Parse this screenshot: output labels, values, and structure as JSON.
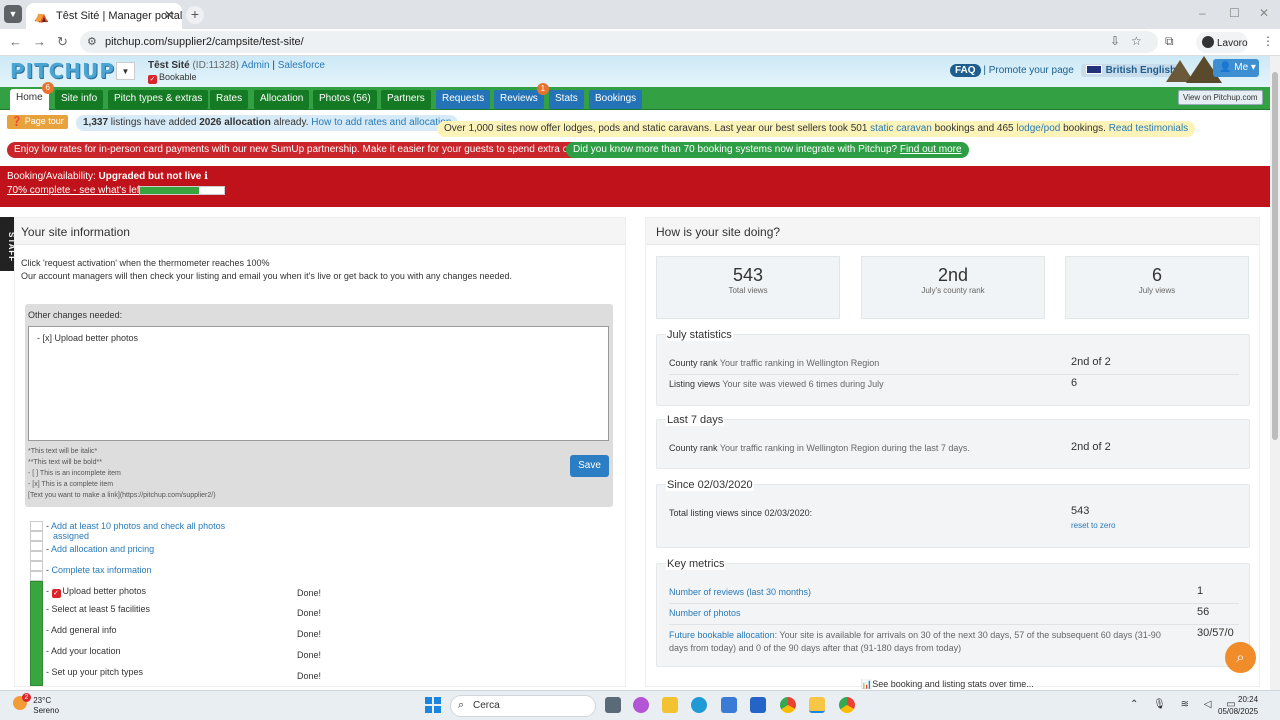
{
  "browser": {
    "tab_title": "Têst Sité | Manager portal | Pitc",
    "url": "pitchup.com/supplier2/campsite/test-site/",
    "profile_label": "Lavoro"
  },
  "header": {
    "logo": "PITCHUP",
    "site_name": "Têst Sité",
    "site_id": "(ID:11328)",
    "admin_link": "Admin",
    "salesforce_link": "Salesforce",
    "bookable": "Bookable",
    "faq": "FAQ",
    "promote": "Promote your page",
    "language": "British English",
    "me": "Me"
  },
  "nav": {
    "home": "Home",
    "home_badge": "6",
    "site_info": "Site info",
    "pitch_types": "Pitch types & extras",
    "rates": "Rates",
    "allocation": "Allocation",
    "photos": "Photos (56)",
    "partners": "Partners",
    "requests": "Requests",
    "reviews": "Reviews",
    "reviews_badge": "1",
    "stats": "Stats",
    "bookings": "Bookings",
    "view_on": "View on Pitchup.com"
  },
  "notices": {
    "page_tour": "Page tour",
    "listings_pre": "1,337",
    "listings_mid": " listings have added ",
    "listings_alloc": "2026 allocation",
    "listings_post": " already. ",
    "listings_link": "How to add rates and allocation",
    "lodges_pre": "Over 1,000 sites now offer lodges, pods and static caravans. Last year our best sellers took 501 ",
    "lodges_link1": "static caravan",
    "lodges_mid": " bookings and 465 ",
    "lodges_link2": "lodge/pod",
    "lodges_post": " bookings. ",
    "lodges_link3": "Read testimonials",
    "sumup": "Enjoy low rates for in-person card payments with our new SumUp partnership. Make it easier for your guests to spend extra on site.",
    "booking_systems": "Did you know more than 70 booking systems now integrate with Pitchup? ",
    "booking_systems_link": "Find out more"
  },
  "status": {
    "label": "Booking/Availability: ",
    "value": "Upgraded but not live",
    "progress_text": "70% complete - see what's left",
    "progress": 0.7
  },
  "staff_tab": "STAFF",
  "left": {
    "title": "Your site information",
    "line1": "Click 'request activation' when the thermometer reaches 100%",
    "line2": "Our account managers will then check your listing and email you when it's live or get back to you with any changes needed.",
    "changes_label": "Other changes needed:",
    "changes_value": " - [x] Upload better photos",
    "help1": "*This text will be italic*",
    "help2": "**This text will be bold**",
    "help3": "- [ ] This is an incomplete item",
    "help4": "- [x] This is a complete item",
    "help5": "[Text you want to make a link](https://pitchup.com/supplier2/)",
    "save": "Save",
    "checklist": [
      {
        "label": "Add at least 10 photos and check all photos",
        "label2": "assigned",
        "done": ""
      },
      {
        "label": "Add allocation and pricing",
        "done": ""
      },
      {
        "label": "Complete tax information",
        "done": ""
      },
      {
        "label": "Upload better photos",
        "done": "Done!"
      },
      {
        "label": "Select at least 5 facilities",
        "done": "Done!"
      },
      {
        "label": "Add general info",
        "done": "Done!"
      },
      {
        "label": "Add your location",
        "done": "Done!"
      },
      {
        "label": "Set up your pitch types",
        "done": "Done!"
      }
    ]
  },
  "right": {
    "title": "How is your site doing?",
    "stats": [
      {
        "value": "543",
        "label": "Total views"
      },
      {
        "value": "2nd",
        "label": "July's county rank"
      },
      {
        "value": "6",
        "label": "July views"
      }
    ],
    "july_title": "July statistics",
    "july_rank_label": "County rank",
    "july_rank_sub": " Your traffic ranking in Wellington Region",
    "july_rank_val": "2nd of 2",
    "july_views_label": "Listing views",
    "july_views_sub": " Your site was viewed 6 times during July",
    "july_views_val": "6",
    "last7_title": "Last 7 days",
    "last7_rank_label": "County rank",
    "last7_rank_sub": " Your traffic ranking in Wellington Region during the last 7 days.",
    "last7_rank_val": "2nd of 2",
    "since_title": "Since 02/03/2020",
    "since_label": "Total listing views since 02/03/2020:",
    "since_val": "543",
    "reset": "reset to zero",
    "key_title": "Key metrics",
    "reviews_link": "Number of reviews (last 30 months)",
    "reviews_val": "1",
    "photos_link": "Number of photos",
    "photos_val": "56",
    "future_link": "Future bookable allocation",
    "future_text1": ": Your site is available for arrivals on 30 of the next 30 days, 57 of the subsequent 60 days (31-90",
    "future_text2": "days from today) and 0 of the 90 days after that (91-180 days from today)",
    "future_val": "30/57/0",
    "see_more": "See booking and listing stats over time..."
  },
  "taskbar": {
    "temp": "23°C",
    "weather": "Sereno",
    "weather_badge": "2",
    "search": "Cerca",
    "time": "20:24",
    "date": "05/08/2025"
  }
}
